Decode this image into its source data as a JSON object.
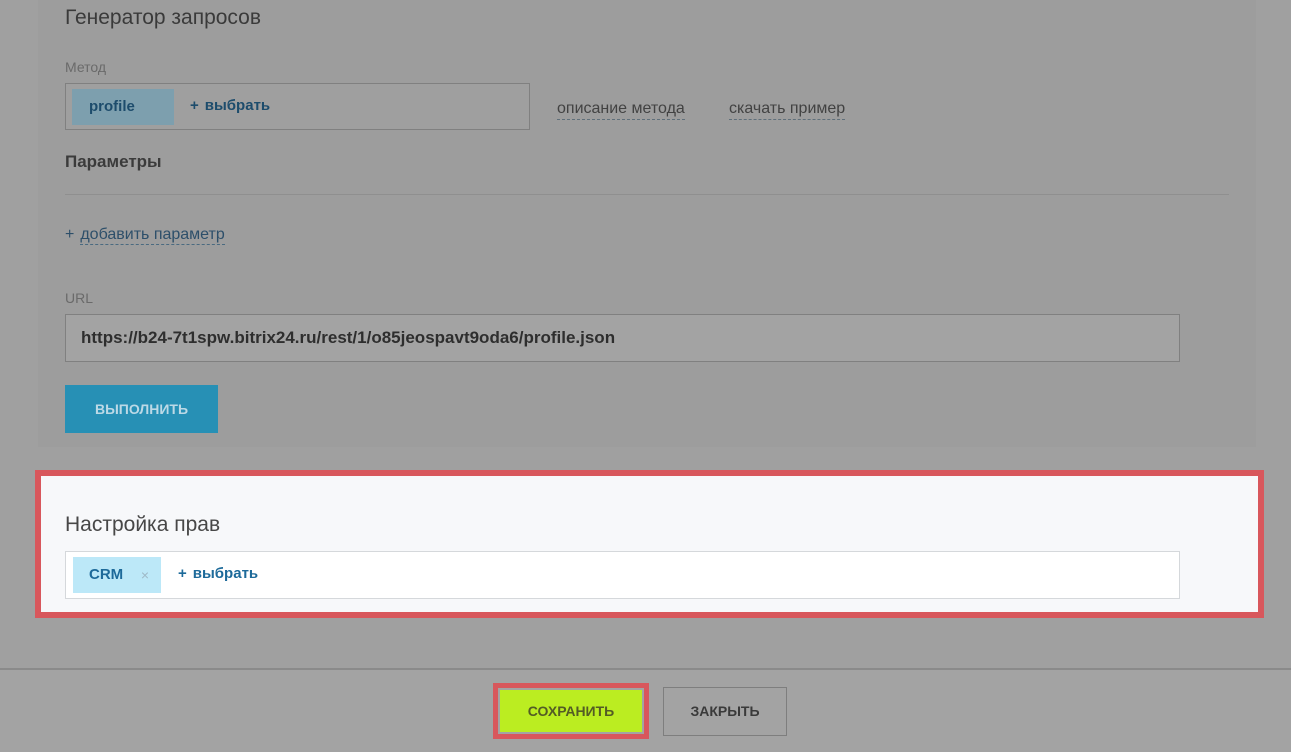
{
  "generator": {
    "title": "Генератор запросов",
    "method_label": "Метод",
    "method_tag": "profile",
    "select_plus": "+",
    "select_label": "выбрать",
    "method_description_link": "описание метода",
    "download_example_link": "скачать пример",
    "params_title": "Параметры",
    "add_param_plus": "+",
    "add_param_label": "добавить параметр",
    "url_label": "URL",
    "url_value": "https://b24-7t1spw.bitrix24.ru/rest/1/o85jeospavt9oda6/profile.json",
    "run_button": "ВЫПОЛНИТЬ"
  },
  "rights": {
    "title": "Настройка прав",
    "tag": "CRM",
    "tag_remove": "×",
    "select_plus": "+",
    "select_label": "выбрать"
  },
  "footer": {
    "save_button": "СОХРАНИТЬ",
    "close_button": "ЗАКРЫТЬ"
  },
  "colors": {
    "highlight_frame": "#d8575c",
    "save_button": "#bbed21",
    "run_button": "#2790b5",
    "tag_background": "#bce8f8"
  }
}
